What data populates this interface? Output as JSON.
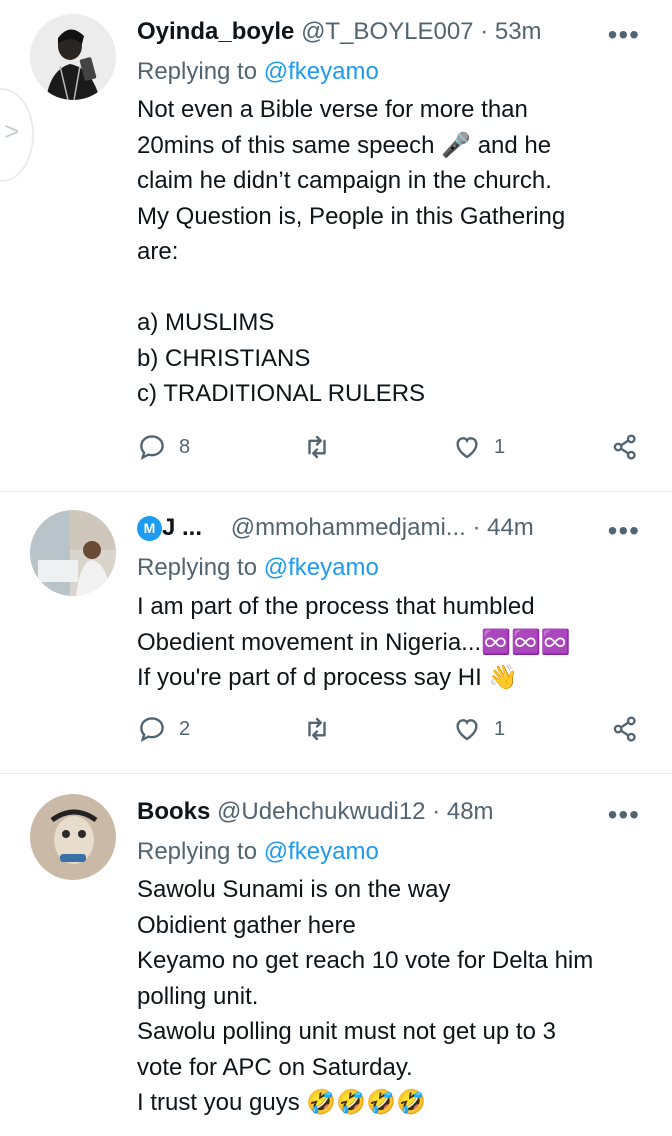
{
  "tweets": [
    {
      "name": "Oyinda_boyle",
      "handle": "@T_BOYLE007",
      "time": "· 53m",
      "replying_prefix": "Replying to",
      "replying_to": "@fkeyamo",
      "text": "Not even a Bible verse for more than\n20mins of this same speech 🎤 and he\nclaim he didn’t campaign in the church.\nMy Question is, People in this Gathering\nare:\n\na) MUSLIMS\nb) CHRISTIANS\nc) TRADITIONAL RULERS",
      "replies": "8",
      "retweets": "",
      "likes": "1"
    },
    {
      "name_badge": "M",
      "name": "J ...",
      "handle": "@mmohammedjami...",
      "time": "· 44m",
      "replying_prefix": "Replying to",
      "replying_to": "@fkeyamo",
      "text": "I am part of the process that humbled\nObedient movement in Nigeria...♾️♾️♾️\nIf you're part of d process say HI 👋",
      "replies": "2",
      "retweets": "",
      "likes": "1"
    },
    {
      "name": "Books",
      "handle": "@Udehchukwudi12",
      "time": "· 48m",
      "replying_prefix": "Replying to",
      "replying_to": "@fkeyamo",
      "text": "Sawolu Sunami is on the way\nObidient gather here\nKeyamo no get reach 10 vote for Delta him\npolling unit.\nSawolu polling unit must not get up to 3\nvote for APC on Saturday.\nI trust you guys 🤣🤣🤣🤣"
    }
  ],
  "more_glyph": "•••",
  "side_chevron": ">",
  "icons": {
    "reply": "reply-icon",
    "retweet": "retweet-icon",
    "like": "heart-icon",
    "share": "share-icon",
    "more": "more-icon"
  },
  "colors": {
    "link": "#1d9bf0",
    "muted": "#536471",
    "text": "#0f1419",
    "divider": "#e6e9ec"
  }
}
